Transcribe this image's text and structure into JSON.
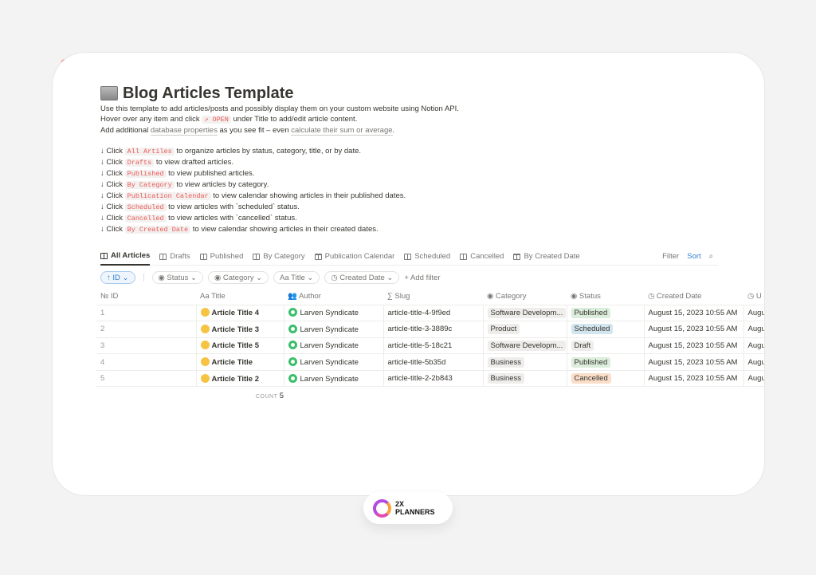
{
  "window": {
    "dots": [
      "#ff5f57",
      "#febc2e",
      "#28c840"
    ]
  },
  "page": {
    "title": "Blog Articles Template",
    "intro": [
      {
        "pre": "Use this template to add articles/posts and possibly display them on your custom website using Notion API."
      },
      {
        "pre": "Hover over any item and click ",
        "code": "↗ OPEN",
        "post": " under Title to add/edit article content."
      },
      {
        "pre": "Add additional ",
        "link1": "database properties",
        "mid": " as you see fit – even ",
        "link2": "calculate their sum or average",
        "post": "."
      }
    ],
    "instructions": [
      {
        "pre": "↓ Click ",
        "code": "All Artiles",
        "post": " to organize articles by status, category, title, or by date."
      },
      {
        "pre": "↓ Click ",
        "code": "Drafts",
        "post": " to view drafted articles."
      },
      {
        "pre": "↓ Click ",
        "code": "Published",
        "post": " to view published articles."
      },
      {
        "pre": "↓ Click ",
        "code": "By Category",
        "post": " to view articles by category."
      },
      {
        "pre": "↓ Click ",
        "code": "Publication Calendar",
        "post": " to view calendar showing articles in their published dates."
      },
      {
        "pre": "↓ Click ",
        "code": "Scheduled",
        "post": " to view articles with `scheduled` status."
      },
      {
        "pre": "↓ Click ",
        "code": "Cancelled",
        "post": " to view articles with `cancelled` status."
      },
      {
        "pre": "↓ Click ",
        "code": "By Created Date",
        "post": " to view calendar showing articles in their created dates."
      }
    ]
  },
  "tabs": [
    {
      "label": "All Articles",
      "icon": "table-icon",
      "active": true
    },
    {
      "label": "Drafts",
      "icon": "table-icon"
    },
    {
      "label": "Published",
      "icon": "table-icon"
    },
    {
      "label": "By Category",
      "icon": "table-icon"
    },
    {
      "label": "Publication Calendar",
      "icon": "calendar-icon"
    },
    {
      "label": "Scheduled",
      "icon": "table-icon"
    },
    {
      "label": "Cancelled",
      "icon": "table-icon"
    },
    {
      "label": "By Created Date",
      "icon": "calendar-icon"
    }
  ],
  "toolbar": {
    "filter": "Filter",
    "sort": "Sort"
  },
  "filters": {
    "sort_chip": "↑ ID ⌄",
    "chips": [
      "◉ Status ⌄",
      "◉ Category ⌄",
      "Aa Title ⌄",
      "◷ Created Date ⌄"
    ],
    "add": "+ Add filter"
  },
  "table": {
    "columns": [
      "№ ID",
      "Aa Title",
      "👥 Author",
      "∑ Slug",
      "◉ Category",
      "◉ Status",
      "◷ Created Date",
      "◷ U"
    ],
    "rows": [
      {
        "id": "1",
        "title": "Article Title 4",
        "author": "Larven Syndicate",
        "slug": "article-title-4-9f9ed",
        "category": "Software Developm...",
        "status": "Published",
        "created": "August 15, 2023 10:55 AM",
        "u": "Augu"
      },
      {
        "id": "2",
        "title": "Article Title 3",
        "author": "Larven Syndicate",
        "slug": "article-title-3-3889c",
        "category": "Product",
        "status": "Scheduled",
        "created": "August 15, 2023 10:55 AM",
        "u": "Augu"
      },
      {
        "id": "3",
        "title": "Article Title 5",
        "author": "Larven Syndicate",
        "slug": "article-title-5-18c21",
        "category": "Software Developm...",
        "status": "Draft",
        "created": "August 15, 2023 10:55 AM",
        "u": "Augu"
      },
      {
        "id": "4",
        "title": "Article Title",
        "author": "Larven Syndicate",
        "slug": "article-title-5b35d",
        "category": "Business",
        "status": "Published",
        "created": "August 15, 2023 10:55 AM",
        "u": "Augu"
      },
      {
        "id": "5",
        "title": "Article Title 2",
        "author": "Larven Syndicate",
        "slug": "article-title-2-2b843",
        "category": "Business",
        "status": "Cancelled",
        "created": "August 15, 2023 10:55 AM",
        "u": "Augu"
      }
    ],
    "count_label": "COUNT",
    "count": "5"
  },
  "status_colors": {
    "Published": "#dbeddb",
    "Scheduled": "#d3e5ef",
    "Draft": "#eeedeb",
    "Cancelled": "#fadec9"
  },
  "brand": {
    "line1": "2X",
    "line2": "PLANNERS"
  }
}
